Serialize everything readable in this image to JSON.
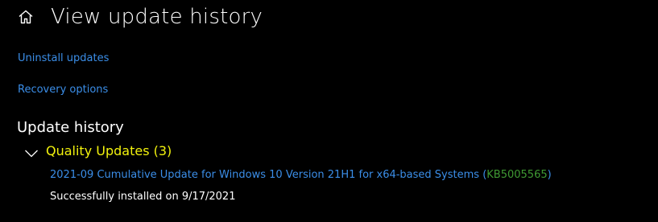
{
  "header": {
    "title": "View update history",
    "home_icon": "home-icon"
  },
  "links": {
    "uninstall": "Uninstall updates",
    "recovery": "Recovery options"
  },
  "history": {
    "section_title": "Update history",
    "groups": [
      {
        "label": "Quality Updates (3)",
        "expanded": true,
        "items": [
          {
            "title": "2021-09 Cumulative Update for Windows 10 Version 21H1 for x64-based Systems",
            "paren_open": "(",
            "kb": "KB5005565",
            "paren_close": ")",
            "status": "Successfully installed on 9/17/2021"
          }
        ]
      }
    ]
  },
  "colors": {
    "background": "#000000",
    "link": "#3b8ee8",
    "group_label": "#f2f20d",
    "kb": "#3f9a33",
    "text": "#ffffff"
  }
}
